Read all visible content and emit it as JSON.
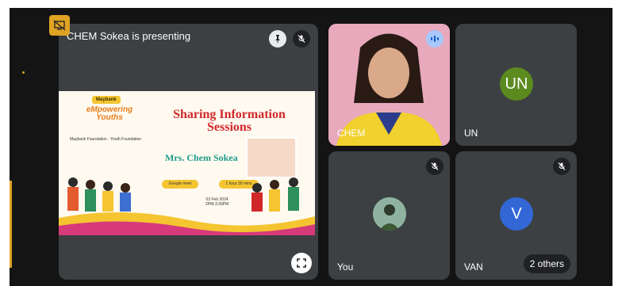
{
  "presentation": {
    "presenter_label": "CHEM Sokea is presenting",
    "slide": {
      "logo": "Maybank",
      "brand": "eMpowering Youths",
      "partners": "Maybank Foundation · Youth Foundation",
      "title": "Sharing Information Sessions",
      "speaker": "Mrs. Chem Sokea",
      "platform": "Google meet",
      "duration": "1 hour 30 mins",
      "date": "03 Feb 2024",
      "time": "2PM-3:30PM"
    }
  },
  "participants": [
    {
      "name": "CHEM",
      "speaking": true
    },
    {
      "name": "UN",
      "initials": "UN",
      "avatar_color": "#5b8a1f"
    },
    {
      "name": "You",
      "muted": true
    },
    {
      "name": "VAN",
      "initials": "V",
      "avatar_color": "#3367d6",
      "muted": true
    }
  ],
  "others_label": "2 others",
  "colors": {
    "tile_bg": "#3c4043",
    "stage_bg": "#141414",
    "accent": "#e0a323"
  }
}
